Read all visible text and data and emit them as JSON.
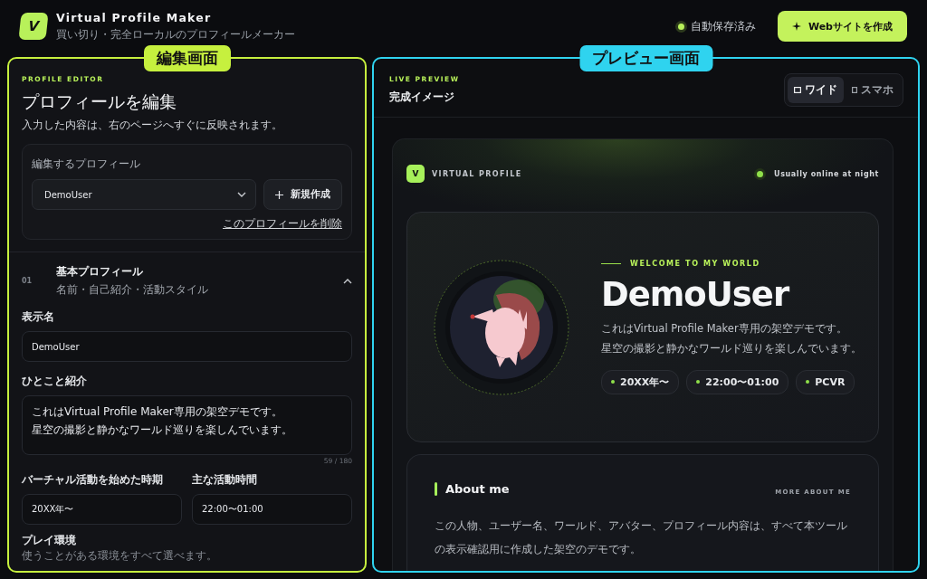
{
  "app": {
    "logo": "V",
    "title": "Virtual Profile Maker",
    "subtitle": "買い切り・完全ローカルのプロフィールメーカー"
  },
  "header": {
    "save_status": "自動保存済み",
    "create_button": "Webサイトを作成"
  },
  "editor": {
    "tag": "編集画面",
    "eyebrow": "PROFILE EDITOR",
    "title": "プロフィールを編集",
    "subtitle": "入力した内容は、右のページへすぐに反映されます。",
    "picker": {
      "label": "編集するプロフィール",
      "value": "DemoUser",
      "new_button": "新規作成",
      "delete_link": "このプロフィールを削除"
    },
    "section": {
      "number": "01",
      "title": "基本プロフィール",
      "subtitle": "名前・自己紹介・活動スタイル",
      "expanded": true
    },
    "fields": [
      {
        "kind": "text",
        "label": "表示名",
        "value": "DemoUser"
      },
      {
        "kind": "textarea",
        "label": "ひとこと紹介",
        "lines": [
          "これはVirtual Profile Maker専用の架空デモです。",
          "星空の撮影と静かなワールド巡りを楽しんでいます。"
        ],
        "counter": "59 / 180"
      }
    ],
    "pair": [
      {
        "label": "バーチャル活動を始めた時期",
        "value": "20XX年〜"
      },
      {
        "label": "主な活動時間",
        "value": "22:00〜01:00"
      }
    ],
    "play_env": {
      "label": "プレイ環境",
      "hint": "使うことがある環境をすべて選べます。"
    }
  },
  "preview": {
    "tag": "プレビュー画面",
    "eyebrow": "LIVE PREVIEW",
    "title": "完成イメージ",
    "view_modes": [
      {
        "label": "ワイド",
        "selected": true
      },
      {
        "label": "スマホ",
        "selected": false
      }
    ],
    "site": {
      "logo": "V",
      "brand": "VIRTUAL PROFILE",
      "status": "Usually online at night",
      "hero": {
        "eyebrow": "WELCOME TO MY WORLD",
        "name": "DemoUser",
        "bio_lines": [
          "これはVirtual Profile Maker専用の架空デモです。",
          "星空の撮影と静かなワールド巡りを楽しんでいます。"
        ],
        "tags": [
          "20XX年〜",
          "22:00〜01:00",
          "PCVR"
        ]
      },
      "about": {
        "title": "About me",
        "more": "MORE ABOUT ME",
        "text": "この人物、ユーザー名、ワールド、アバター、プロフィール内容は、すべて本ツールの表示確認用に作成した架空のデモです。"
      }
    }
  }
}
